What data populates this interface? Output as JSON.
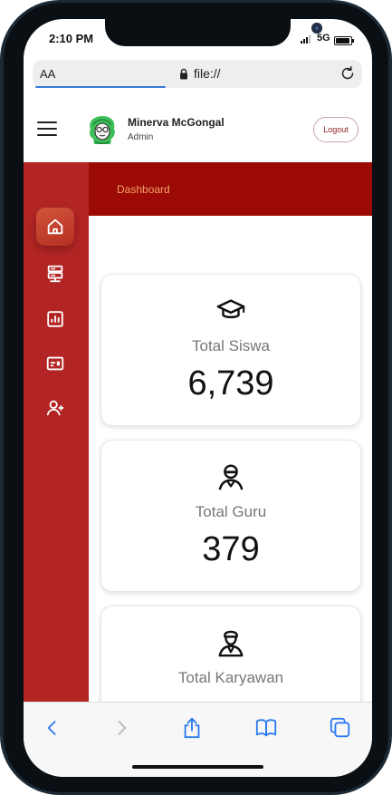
{
  "status_bar": {
    "time": "2:10 PM",
    "network": "5G"
  },
  "browser": {
    "aa_label": "AA",
    "url": "file://"
  },
  "header": {
    "user_name": "Minerva McGongal",
    "user_role": "Admin",
    "logout_label": "Logout"
  },
  "breadcrumb": {
    "label": "Dashboard"
  },
  "sidebar": {
    "items": [
      {
        "name": "home",
        "icon": "home-icon",
        "active": true
      },
      {
        "name": "server",
        "icon": "server-icon",
        "active": false
      },
      {
        "name": "chart",
        "icon": "bar-chart-icon",
        "active": false
      },
      {
        "name": "id-card",
        "icon": "id-card-icon",
        "active": false
      },
      {
        "name": "add-user",
        "icon": "user-plus-icon",
        "active": false
      }
    ]
  },
  "stats": [
    {
      "icon": "graduation-cap-icon",
      "label": "Total Siswa",
      "value": "6,739"
    },
    {
      "icon": "teacher-icon",
      "label": "Total Guru",
      "value": "379"
    },
    {
      "icon": "employee-icon",
      "label": "Total Karyawan",
      "value": ""
    }
  ],
  "colors": {
    "sidebar": "#b32524",
    "breadcrumb_bar": "#9b0a05",
    "breadcrumb_text": "#f2a267",
    "active_nav": "#d2533a",
    "safari_blue": "#3a7bd5"
  }
}
